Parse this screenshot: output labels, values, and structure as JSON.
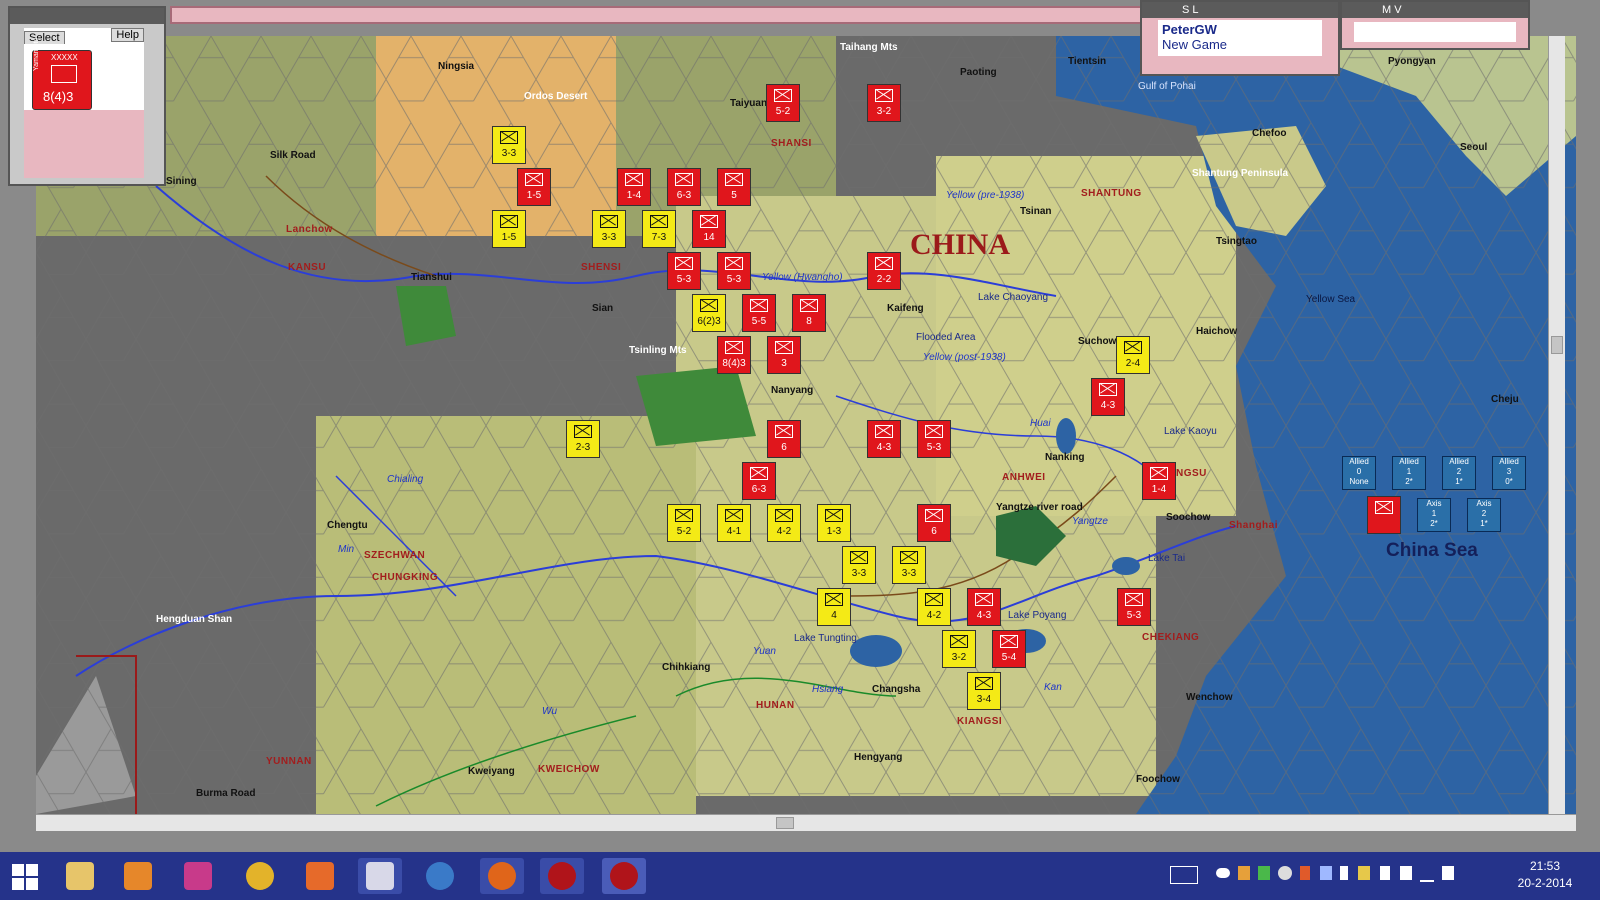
{
  "select_panel": {
    "tabs": [
      "Select",
      "Help"
    ],
    "card": {
      "side_label": "Yamamoto",
      "rank": "XXXXX",
      "value": "8(4)3"
    }
  },
  "player_panel_1": {
    "title": "S L",
    "player": "PeterGW",
    "status": "New Game"
  },
  "player_panel_2": {
    "title": "M V"
  },
  "map": {
    "country_label": "CHINA",
    "sea_label": "China Sea",
    "regions": [
      "SHANSI",
      "SHENSI",
      "KANSU",
      "SHANTUNG",
      "SZECHWAN",
      "ANHWEI",
      "NGSU",
      "HUNAN",
      "KIANGSI",
      "CHEKIANG",
      "YUNNAN",
      "KWEICHOW",
      "CHUNGKING"
    ],
    "cities": [
      "Ningsia",
      "Taiyuan",
      "Paoting",
      "Tientsin",
      "Tsinan",
      "Tsingtao",
      "Lanchow",
      "Tianshui",
      "Sian",
      "Kaifeng",
      "Nanyang",
      "Suchow",
      "Haichow",
      "Chengtu",
      "Nanking",
      "Soochow",
      "Shanghai",
      "Chihkiang",
      "Changsha",
      "Hengyang",
      "Kweiyang",
      "Wenchow",
      "Foochow",
      "Pyongyan",
      "Seoul",
      "Chefoo",
      "Sining"
    ],
    "features": [
      "Taihang Mts",
      "Ordos Desert",
      "Silk Road",
      "Tsinling Mts",
      "Hengduan Shan",
      "Burma Road",
      "Lake Chaoyang",
      "Flooded Area",
      "Lake Kaoyu",
      "Lake Tai",
      "Yangtze river road",
      "Lake Tungting",
      "Lake Poyang",
      "Shantung Peninsula",
      "Gulf of Pohai",
      "Yellow Sea",
      "Cheju"
    ],
    "rivers": [
      "Yellow (pre-1938)",
      "Yellow (Hwangho)",
      "Yellow (post-1938)",
      "Huai",
      "Chialing",
      "Min",
      "Yangtze",
      "Hsiang",
      "Yuan",
      "Wu",
      "Kan"
    ],
    "sea_boxes": {
      "allied": [
        {
          "label": "Allied",
          "n": "0",
          "sub": "None"
        },
        {
          "label": "Allied",
          "n": "1",
          "sub": "2*"
        },
        {
          "label": "Allied",
          "n": "2",
          "sub": "1*"
        },
        {
          "label": "Allied",
          "n": "3",
          "sub": "0*"
        }
      ],
      "axis": [
        {
          "label": "Axis",
          "n": "1",
          "sub": "2*"
        },
        {
          "label": "Axis",
          "n": "2",
          "sub": "1*"
        }
      ]
    },
    "units": [
      {
        "color": "red",
        "value": "5-2"
      },
      {
        "color": "red",
        "value": "3-2"
      },
      {
        "color": "yellow",
        "value": "3-3"
      },
      {
        "color": "red",
        "value": "1-5"
      },
      {
        "color": "red",
        "value": "1-4"
      },
      {
        "color": "red",
        "value": "6-3"
      },
      {
        "color": "red",
        "value": "5"
      },
      {
        "color": "yellow",
        "value": "1-5"
      },
      {
        "color": "yellow",
        "value": "3-3"
      },
      {
        "color": "yellow",
        "value": "7-3"
      },
      {
        "color": "red",
        "value": "14"
      },
      {
        "color": "red",
        "value": "5-3"
      },
      {
        "color": "red",
        "value": "5-3"
      },
      {
        "color": "red",
        "value": "2-2"
      },
      {
        "color": "yellow",
        "value": "6(2)3"
      },
      {
        "color": "red",
        "value": "5-5"
      },
      {
        "color": "red",
        "value": "8"
      },
      {
        "color": "red",
        "value": "8(4)3"
      },
      {
        "color": "red",
        "value": "3"
      },
      {
        "color": "yellow",
        "value": "2-4"
      },
      {
        "color": "red",
        "value": "4-3"
      },
      {
        "color": "yellow",
        "value": "2-3"
      },
      {
        "color": "red",
        "value": "6"
      },
      {
        "color": "red",
        "value": "4-3"
      },
      {
        "color": "red",
        "value": "5-3"
      },
      {
        "color": "red",
        "value": "6-3"
      },
      {
        "color": "red",
        "value": "1-4"
      },
      {
        "color": "yellow",
        "value": "5-2"
      },
      {
        "color": "yellow",
        "value": "4-1"
      },
      {
        "color": "yellow",
        "value": "4-2"
      },
      {
        "color": "yellow",
        "value": "1-3"
      },
      {
        "color": "red",
        "value": "6"
      },
      {
        "color": "yellow",
        "value": "3-3"
      },
      {
        "color": "yellow",
        "value": "3-3"
      },
      {
        "color": "yellow",
        "value": "4"
      },
      {
        "color": "yellow",
        "value": "4-2"
      },
      {
        "color": "red",
        "value": "4-3"
      },
      {
        "color": "red",
        "value": "5-3"
      },
      {
        "color": "yellow",
        "value": "3-2"
      },
      {
        "color": "red",
        "value": "5-4"
      },
      {
        "color": "yellow",
        "value": "3-4"
      }
    ]
  },
  "taskbar": {
    "apps": [
      "explorer",
      "media-player",
      "paint-app",
      "chrome",
      "mail",
      "document-app",
      "thunderbird",
      "firefox",
      "wif-1",
      "wif-2"
    ],
    "time": "21:53",
    "date": "20-2-2014"
  },
  "colors": {
    "pink_panel": "#e8b7c0",
    "taskbar": "#25338a",
    "axis_red": "#e0161c",
    "china_yellow": "#f4ea16",
    "sea_blue": "#2a6fa8"
  }
}
